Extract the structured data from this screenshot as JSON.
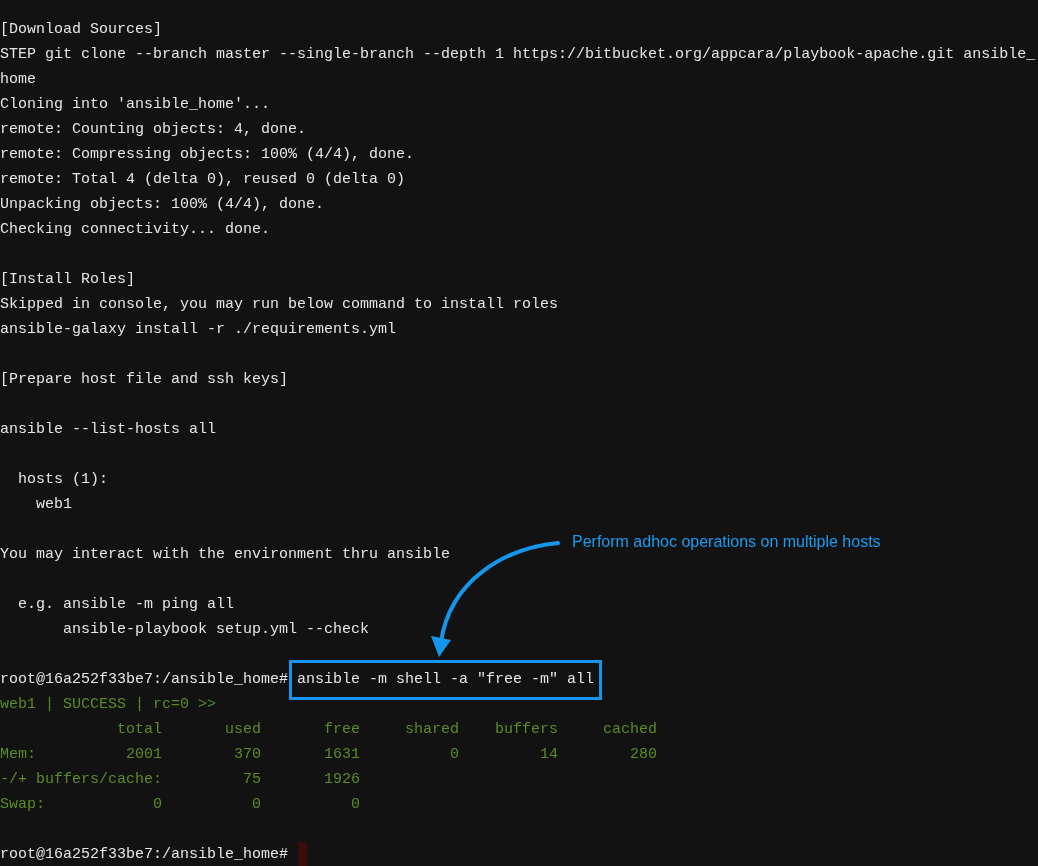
{
  "terminal": {
    "lines": [
      {
        "kind": "text",
        "text": "[Download Sources]"
      },
      {
        "kind": "text",
        "text": "STEP git clone --branch master --single-branch --depth 1 https://bitbucket.org/appcara/playbook-apache.git ansible_"
      },
      {
        "kind": "text",
        "text": "home"
      },
      {
        "kind": "text",
        "text": "Cloning into 'ansible_home'..."
      },
      {
        "kind": "text",
        "text": "remote: Counting objects: 4, done."
      },
      {
        "kind": "text",
        "text": "remote: Compressing objects: 100% (4/4), done."
      },
      {
        "kind": "text",
        "text": "remote: Total 4 (delta 0), reused 0 (delta 0)"
      },
      {
        "kind": "text",
        "text": "Unpacking objects: 100% (4/4), done."
      },
      {
        "kind": "text",
        "text": "Checking connectivity... done."
      },
      {
        "kind": "blank"
      },
      {
        "kind": "text",
        "text": "[Install Roles]"
      },
      {
        "kind": "text",
        "text": "Skipped in console, you may run below command to install roles"
      },
      {
        "kind": "text",
        "text": "ansible-galaxy install -r ./requirements.yml"
      },
      {
        "kind": "blank"
      },
      {
        "kind": "text",
        "text": "[Prepare host file and ssh keys]"
      },
      {
        "kind": "blank"
      },
      {
        "kind": "text",
        "text": "ansible --list-hosts all"
      },
      {
        "kind": "blank"
      },
      {
        "kind": "text",
        "text": "  hosts (1):"
      },
      {
        "kind": "text",
        "text": "    web1"
      },
      {
        "kind": "blank"
      },
      {
        "kind": "text",
        "text": "You may interact with the environment thru ansible"
      },
      {
        "kind": "blank"
      },
      {
        "kind": "text",
        "text": "  e.g. ansible -m ping all"
      },
      {
        "kind": "text",
        "text": "       ansible-playbook setup.yml --check"
      },
      {
        "kind": "blank"
      },
      {
        "kind": "prompt",
        "prompt": "root@16a252f33be7:/ansible_home#",
        "command": "ansible -m shell -a \"free -m\" all",
        "highlighted": true
      },
      {
        "kind": "success",
        "text": "web1 | SUCCESS | rc=0 >>"
      },
      {
        "kind": "success",
        "text": "             total       used       free     shared    buffers     cached"
      },
      {
        "kind": "success",
        "text": "Mem:          2001        370       1631          0         14        280"
      },
      {
        "kind": "success",
        "text": "-/+ buffers/cache:         75       1926"
      },
      {
        "kind": "success",
        "text": "Swap:            0          0          0"
      },
      {
        "kind": "blank"
      },
      {
        "kind": "prompt",
        "prompt": "root@16a252f33be7:/ansible_home#",
        "cursor": true
      }
    ]
  },
  "annotation": {
    "text": "Perform adhoc operations on multiple hosts"
  }
}
